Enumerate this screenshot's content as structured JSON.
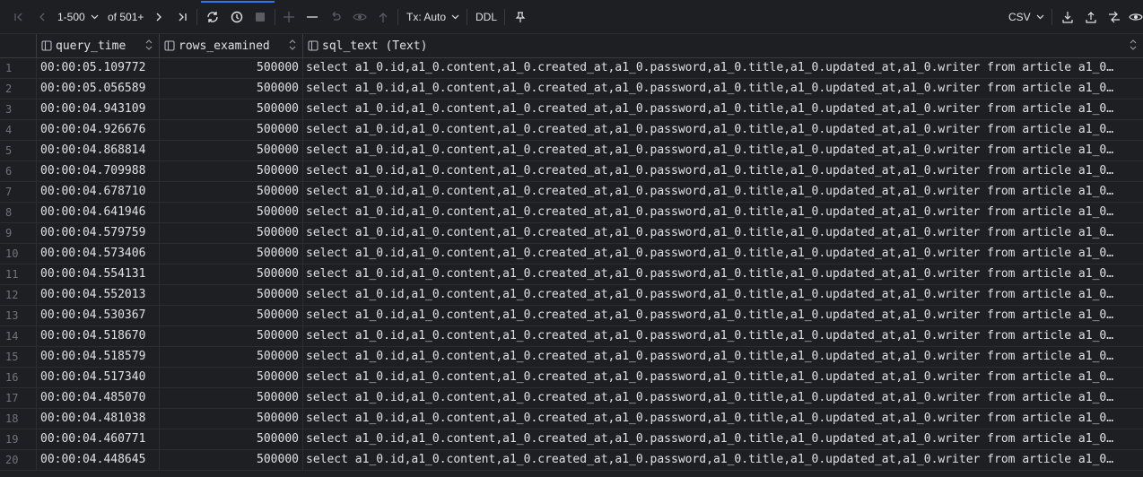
{
  "toolbar": {
    "range_label": "1-500",
    "total_label": "of 501+",
    "tx_label": "Tx: Auto",
    "ddl_label": "DDL",
    "export_format": "CSV"
  },
  "columns": [
    {
      "name": "query_time"
    },
    {
      "name": "rows_examined"
    },
    {
      "name": "sql_text (Text)"
    }
  ],
  "rows": [
    {
      "n": "1",
      "query_time": "00:00:05.109772",
      "rows_examined": "500000",
      "sql_text": "select a1_0.id,a1_0.content,a1_0.created_at,a1_0.password,a1_0.title,a1_0.updated_at,a1_0.writer from article a1_0…"
    },
    {
      "n": "2",
      "query_time": "00:00:05.056589",
      "rows_examined": "500000",
      "sql_text": "select a1_0.id,a1_0.content,a1_0.created_at,a1_0.password,a1_0.title,a1_0.updated_at,a1_0.writer from article a1_0…"
    },
    {
      "n": "3",
      "query_time": "00:00:04.943109",
      "rows_examined": "500000",
      "sql_text": "select a1_0.id,a1_0.content,a1_0.created_at,a1_0.password,a1_0.title,a1_0.updated_at,a1_0.writer from article a1_0…"
    },
    {
      "n": "4",
      "query_time": "00:00:04.926676",
      "rows_examined": "500000",
      "sql_text": "select a1_0.id,a1_0.content,a1_0.created_at,a1_0.password,a1_0.title,a1_0.updated_at,a1_0.writer from article a1_0…"
    },
    {
      "n": "5",
      "query_time": "00:00:04.868814",
      "rows_examined": "500000",
      "sql_text": "select a1_0.id,a1_0.content,a1_0.created_at,a1_0.password,a1_0.title,a1_0.updated_at,a1_0.writer from article a1_0…"
    },
    {
      "n": "6",
      "query_time": "00:00:04.709988",
      "rows_examined": "500000",
      "sql_text": "select a1_0.id,a1_0.content,a1_0.created_at,a1_0.password,a1_0.title,a1_0.updated_at,a1_0.writer from article a1_0…"
    },
    {
      "n": "7",
      "query_time": "00:00:04.678710",
      "rows_examined": "500000",
      "sql_text": "select a1_0.id,a1_0.content,a1_0.created_at,a1_0.password,a1_0.title,a1_0.updated_at,a1_0.writer from article a1_0…"
    },
    {
      "n": "8",
      "query_time": "00:00:04.641946",
      "rows_examined": "500000",
      "sql_text": "select a1_0.id,a1_0.content,a1_0.created_at,a1_0.password,a1_0.title,a1_0.updated_at,a1_0.writer from article a1_0…"
    },
    {
      "n": "9",
      "query_time": "00:00:04.579759",
      "rows_examined": "500000",
      "sql_text": "select a1_0.id,a1_0.content,a1_0.created_at,a1_0.password,a1_0.title,a1_0.updated_at,a1_0.writer from article a1_0…"
    },
    {
      "n": "10",
      "query_time": "00:00:04.573406",
      "rows_examined": "500000",
      "sql_text": "select a1_0.id,a1_0.content,a1_0.created_at,a1_0.password,a1_0.title,a1_0.updated_at,a1_0.writer from article a1_0…"
    },
    {
      "n": "11",
      "query_time": "00:00:04.554131",
      "rows_examined": "500000",
      "sql_text": "select a1_0.id,a1_0.content,a1_0.created_at,a1_0.password,a1_0.title,a1_0.updated_at,a1_0.writer from article a1_0…"
    },
    {
      "n": "12",
      "query_time": "00:00:04.552013",
      "rows_examined": "500000",
      "sql_text": "select a1_0.id,a1_0.content,a1_0.created_at,a1_0.password,a1_0.title,a1_0.updated_at,a1_0.writer from article a1_0…"
    },
    {
      "n": "13",
      "query_time": "00:00:04.530367",
      "rows_examined": "500000",
      "sql_text": "select a1_0.id,a1_0.content,a1_0.created_at,a1_0.password,a1_0.title,a1_0.updated_at,a1_0.writer from article a1_0…"
    },
    {
      "n": "14",
      "query_time": "00:00:04.518670",
      "rows_examined": "500000",
      "sql_text": "select a1_0.id,a1_0.content,a1_0.created_at,a1_0.password,a1_0.title,a1_0.updated_at,a1_0.writer from article a1_0…"
    },
    {
      "n": "15",
      "query_time": "00:00:04.518579",
      "rows_examined": "500000",
      "sql_text": "select a1_0.id,a1_0.content,a1_0.created_at,a1_0.password,a1_0.title,a1_0.updated_at,a1_0.writer from article a1_0…"
    },
    {
      "n": "16",
      "query_time": "00:00:04.517340",
      "rows_examined": "500000",
      "sql_text": "select a1_0.id,a1_0.content,a1_0.created_at,a1_0.password,a1_0.title,a1_0.updated_at,a1_0.writer from article a1_0…"
    },
    {
      "n": "17",
      "query_time": "00:00:04.485070",
      "rows_examined": "500000",
      "sql_text": "select a1_0.id,a1_0.content,a1_0.created_at,a1_0.password,a1_0.title,a1_0.updated_at,a1_0.writer from article a1_0…"
    },
    {
      "n": "18",
      "query_time": "00:00:04.481038",
      "rows_examined": "500000",
      "sql_text": "select a1_0.id,a1_0.content,a1_0.created_at,a1_0.password,a1_0.title,a1_0.updated_at,a1_0.writer from article a1_0…"
    },
    {
      "n": "19",
      "query_time": "00:00:04.460771",
      "rows_examined": "500000",
      "sql_text": "select a1_0.id,a1_0.content,a1_0.created_at,a1_0.password,a1_0.title,a1_0.updated_at,a1_0.writer from article a1_0…"
    },
    {
      "n": "20",
      "query_time": "00:00:04.448645",
      "rows_examined": "500000",
      "sql_text": "select a1_0.id,a1_0.content,a1_0.created_at,a1_0.password,a1_0.title,a1_0.updated_at,a1_0.writer from article a1_0…"
    }
  ]
}
